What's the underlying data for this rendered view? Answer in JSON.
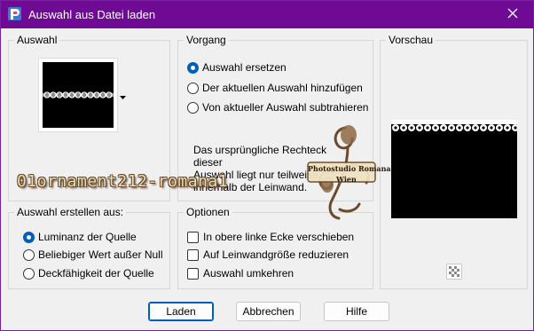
{
  "window": {
    "title": "Auswahl aus Datei laden",
    "accent_color": "#6f0a94",
    "app_icon": "paintshop-icon",
    "close_icon": "close-icon"
  },
  "auswahl": {
    "title": "Auswahl",
    "dropdown_icon": "dropdown-arrow-icon"
  },
  "vorgang": {
    "title": "Vorgang",
    "options": [
      {
        "label": "Auswahl ersetzen",
        "selected": true
      },
      {
        "label": "Der aktuellen Auswahl hinzufügen",
        "selected": false
      },
      {
        "label": "Von aktueller Auswahl subtrahieren",
        "selected": false
      }
    ],
    "info_text": "Das ursprüngliche Rechteck dieser\nAuswahl liegt nur teilweise\ninnerhalb der Leinwand."
  },
  "vorschau": {
    "title": "Vorschau",
    "transparency_icon": "checkerboard-icon"
  },
  "erstellen": {
    "title": "Auswahl erstellen aus:",
    "options": [
      {
        "label": "Luminanz der Quelle",
        "selected": true
      },
      {
        "label": "Beliebiger Wert außer Null",
        "selected": false
      },
      {
        "label": "Deckfähigkeit der Quelle",
        "selected": false
      }
    ]
  },
  "optionen": {
    "title": "Optionen",
    "options": [
      {
        "label": "In obere linke Ecke verschieben",
        "checked": false
      },
      {
        "label": "Auf Leinwandgröße reduzieren",
        "checked": false
      },
      {
        "label": "Auswahl umkehren",
        "checked": false
      }
    ]
  },
  "buttons": {
    "load": "Laden",
    "cancel": "Abbrechen",
    "help": "Hilfe"
  },
  "overlay": {
    "watermark": "01ornament212-romana1",
    "seal_line1": "Photostudio Romana",
    "seal_line2": "Wien"
  }
}
